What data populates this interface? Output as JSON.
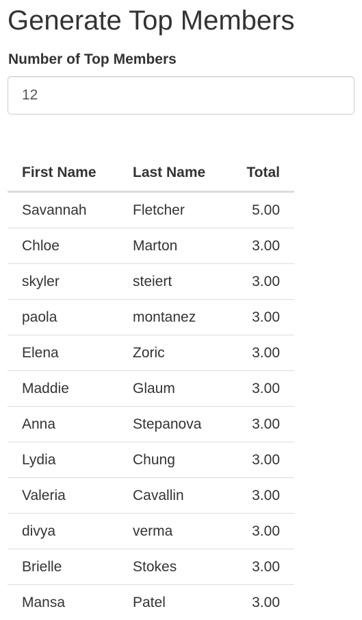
{
  "page": {
    "title": "Generate Top Members"
  },
  "form": {
    "label": "Number of Top Members",
    "value": "12"
  },
  "table": {
    "headers": {
      "first": "First Name",
      "last": "Last Name",
      "total": "Total"
    },
    "rows": [
      {
        "first": "Savannah",
        "last": "Fletcher",
        "total": "5.00"
      },
      {
        "first": "Chloe",
        "last": "Marton",
        "total": "3.00"
      },
      {
        "first": "skyler",
        "last": "steiert",
        "total": "3.00"
      },
      {
        "first": "paola",
        "last": "montanez",
        "total": "3.00"
      },
      {
        "first": "Elena",
        "last": "Zoric",
        "total": "3.00"
      },
      {
        "first": "Maddie",
        "last": "Glaum",
        "total": "3.00"
      },
      {
        "first": "Anna",
        "last": "Stepanova",
        "total": "3.00"
      },
      {
        "first": "Lydia",
        "last": "Chung",
        "total": "3.00"
      },
      {
        "first": "Valeria",
        "last": "Cavallin",
        "total": "3.00"
      },
      {
        "first": "divya",
        "last": "verma",
        "total": "3.00"
      },
      {
        "first": "Brielle",
        "last": "Stokes",
        "total": "3.00"
      },
      {
        "first": "Mansa",
        "last": "Patel",
        "total": "3.00"
      }
    ]
  }
}
